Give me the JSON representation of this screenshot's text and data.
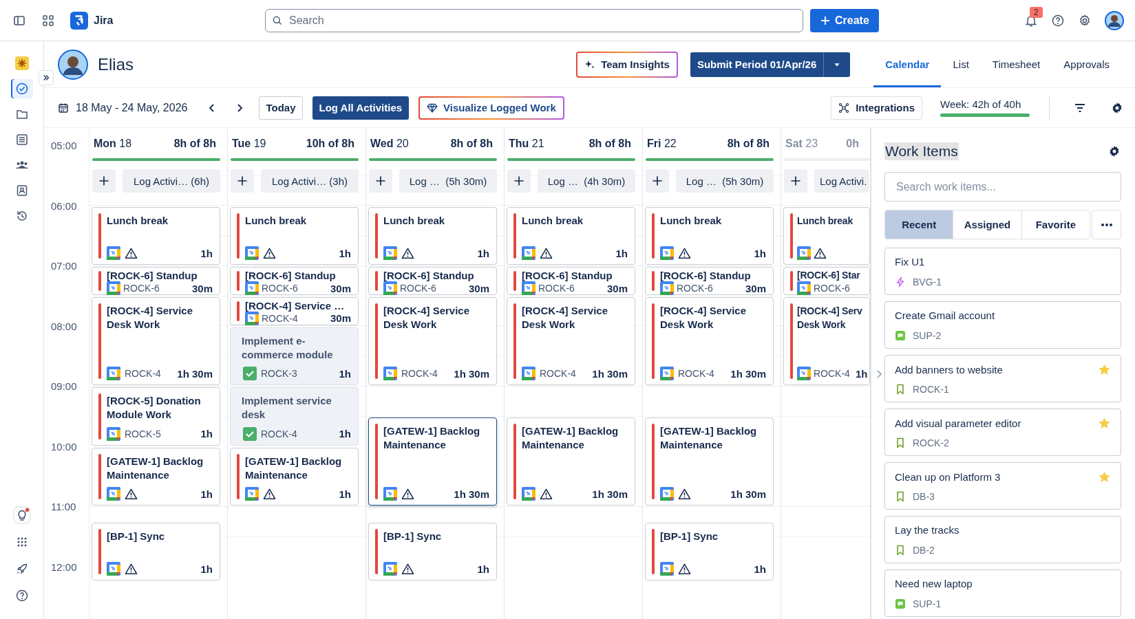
{
  "top_bar": {
    "app_name": "Jira",
    "search": {
      "placeholder": "Search"
    },
    "create_button": "Create",
    "notification_count": "2"
  },
  "rail_items": [
    {
      "kind": "logo",
      "selected": false
    },
    {
      "kind": "check",
      "selected": true
    },
    {
      "kind": "folder",
      "selected": false
    },
    {
      "kind": "list",
      "selected": false
    },
    {
      "kind": "people",
      "selected": false
    },
    {
      "kind": "contact",
      "selected": false
    },
    {
      "kind": "history",
      "selected": false
    }
  ],
  "rail_bottom": [
    {
      "kind": "bulb",
      "selected": false
    },
    {
      "kind": "apps",
      "selected": false
    },
    {
      "kind": "rocket",
      "selected": false
    },
    {
      "kind": "help",
      "selected": false
    }
  ],
  "user": {
    "name": "Elias"
  },
  "header_buttons": {
    "team_insights": "Team Insights",
    "submit_period": "Submit Period 01/Apr/26"
  },
  "view_tabs": [
    {
      "label": "Calendar",
      "selected": true
    },
    {
      "label": "List",
      "selected": false
    },
    {
      "label": "Timesheet",
      "selected": false
    },
    {
      "label": "Approvals",
      "selected": false
    }
  ],
  "toolbar": {
    "date_range": "18 May - 24 May, 2026",
    "today": "Today",
    "log_all": "Log All Activities",
    "visualize": "Visualize Logged Work",
    "integrations": "Integrations",
    "week": {
      "label": "Week: 42h of 40h",
      "level": 1
    }
  },
  "time_labels": [
    "05:00",
    "06:00",
    "07:00",
    "08:00",
    "09:00",
    "10:00",
    "11:00",
    "12:00"
  ],
  "days": [
    {
      "name": "Mon",
      "date": "18",
      "hours": "8h of 8h",
      "level": 1,
      "weekend": false,
      "log_button": "Log Activi… (6h)",
      "events": [
        {
          "kind": "event",
          "title": "Lunch break",
          "duration": "1h",
          "selected": false
        },
        {
          "kind": "issue",
          "title": "[ROCK-6] Standup",
          "key": "ROCK-6",
          "duration": "30m",
          "selected": false
        },
        {
          "kind": "issue",
          "title": "[ROCK-4] Service Desk Work",
          "key": "ROCK-4",
          "duration": "1h 30m",
          "selected": false
        },
        {
          "kind": "issue",
          "title": "[ROCK-5] Donation Module Work",
          "key": "ROCK-5",
          "duration": "1h",
          "selected": false
        },
        {
          "kind": "event",
          "title": "[GATEW-1] Backlog Maintenance",
          "duration": "1h",
          "selected": false
        },
        {
          "kind": "event",
          "title": "[BP-1] Sync",
          "duration": "1h",
          "selected": false
        }
      ]
    },
    {
      "name": "Tue",
      "date": "19",
      "hours": "10h of 8h",
      "level": 1,
      "weekend": false,
      "log_button": "Log Activi… (3h)",
      "events": [
        {
          "kind": "event",
          "title": "Lunch break",
          "duration": "1h",
          "selected": false
        },
        {
          "kind": "issue",
          "title": "[ROCK-6] Standup",
          "key": "ROCK-6",
          "duration": "30m",
          "selected": false
        },
        {
          "kind": "issue",
          "title": "[ROCK-4] Service …",
          "key": "ROCK-4",
          "duration": "30m",
          "selected": false
        },
        {
          "kind": "task",
          "title": "Implement e-commerce module",
          "key": "ROCK-3",
          "duration": "1h",
          "selected": false
        },
        {
          "kind": "task",
          "title": "Implement service desk",
          "key": "ROCK-4",
          "duration": "1h",
          "selected": false
        },
        {
          "kind": "event",
          "title": "[GATEW-1] Backlog Maintenance",
          "duration": "1h",
          "selected": false
        }
      ]
    },
    {
      "name": "Wed",
      "date": "20",
      "hours": "8h of 8h",
      "level": 1,
      "weekend": false,
      "log_button": "Log …  (5h 30m)",
      "events": [
        {
          "kind": "event",
          "title": "Lunch break",
          "duration": "1h",
          "selected": false
        },
        {
          "kind": "issue",
          "title": "[ROCK-6] Standup",
          "key": "ROCK-6",
          "duration": "30m",
          "selected": false
        },
        {
          "kind": "issue",
          "title": "[ROCK-4] Service Desk Work",
          "key": "ROCK-4",
          "duration": "1h 30m",
          "selected": false
        },
        {
          "kind": "event",
          "title": "[GATEW-1] Backlog Maintenance",
          "duration": "1h 30m",
          "selected": true
        },
        {
          "kind": "event",
          "title": "[BP-1] Sync",
          "duration": "1h",
          "selected": false
        }
      ]
    },
    {
      "name": "Thu",
      "date": "21",
      "hours": "8h of 8h",
      "level": 1,
      "weekend": false,
      "log_button": "Log …  (4h 30m)",
      "events": [
        {
          "kind": "event",
          "title": "Lunch break",
          "duration": "1h",
          "selected": false
        },
        {
          "kind": "issue",
          "title": "[ROCK-6] Standup",
          "key": "ROCK-6",
          "duration": "30m",
          "selected": false
        },
        {
          "kind": "issue",
          "title": "[ROCK-4] Service Desk Work",
          "key": "ROCK-4",
          "duration": "1h 30m",
          "selected": false
        },
        {
          "kind": "event",
          "title": "[GATEW-1] Backlog Maintenance",
          "duration": "1h 30m",
          "selected": false
        }
      ]
    },
    {
      "name": "Fri",
      "date": "22",
      "hours": "8h of 8h",
      "level": 1,
      "weekend": false,
      "log_button": "Log …  (5h 30m)",
      "events": [
        {
          "kind": "event",
          "title": "Lunch break",
          "duration": "1h",
          "selected": false
        },
        {
          "kind": "issue",
          "title": "[ROCK-6] Standup",
          "key": "ROCK-6",
          "duration": "30m",
          "selected": false
        },
        {
          "kind": "issue",
          "title": "[ROCK-4] Service Desk Work",
          "key": "ROCK-4",
          "duration": "1h 30m",
          "selected": false
        },
        {
          "kind": "event",
          "title": "[GATEW-1] Backlog Maintenance",
          "duration": "1h 30m",
          "selected": false
        },
        {
          "kind": "event",
          "title": "[BP-1] Sync",
          "duration": "1h",
          "selected": false
        }
      ]
    },
    {
      "name": "Sat",
      "date": "23",
      "hours": "0h",
      "level": 0,
      "weekend": true,
      "log_button": "Log Activi.",
      "events": [
        {
          "kind": "event",
          "title": "Lunch break",
          "selected": false
        },
        {
          "kind": "issue",
          "title": "[ROCK-6] Star",
          "key": "ROCK-6",
          "selected": false
        },
        {
          "kind": "issue",
          "title": "[ROCK-4] Serv\nDesk Work",
          "key": "ROCK-4",
          "duration": "1h",
          "selected": false
        }
      ]
    }
  ],
  "work_items": {
    "title": "Work Items",
    "search": {
      "placeholder": "Search work items..."
    },
    "tabs": [
      {
        "label": "Recent",
        "selected": true
      },
      {
        "label": "Assigned",
        "selected": false
      },
      {
        "label": "Favorite",
        "selected": false
      }
    ],
    "items": [
      {
        "title": "Fix U1",
        "kind": "epic",
        "key": "BVG-1",
        "starred": false
      },
      {
        "title": "Create Gmail account",
        "kind": "support",
        "key": "SUP-2",
        "starred": false
      },
      {
        "title": "Add banners to website",
        "kind": "story",
        "key": "ROCK-1",
        "starred": true
      },
      {
        "title": "Add visual parameter editor",
        "kind": "story",
        "key": "ROCK-2",
        "starred": true
      },
      {
        "title": "Clean up on Platform 3",
        "kind": "story",
        "key": "DB-3",
        "starred": true
      },
      {
        "title": "Lay the tracks",
        "kind": "story",
        "key": "DB-2",
        "starred": false
      },
      {
        "title": "Need new laptop",
        "kind": "support",
        "key": "SUP-1",
        "starred": false
      }
    ]
  }
}
